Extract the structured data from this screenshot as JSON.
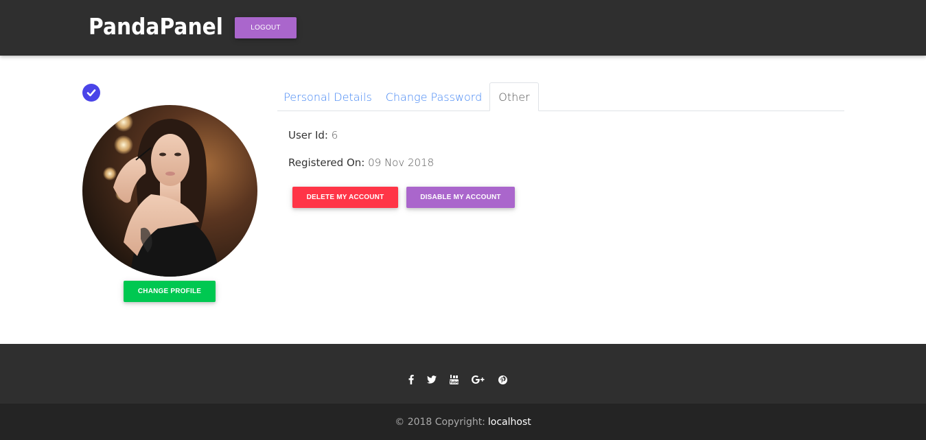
{
  "header": {
    "brand": "PandaPanel",
    "logout_label": "LOGOUT",
    "logout_color": "#aa66cc"
  },
  "profile": {
    "verified_icon": "check-circle-icon",
    "avatar_alt": "profile photo",
    "change_profile_label": "CHANGE PROFILE"
  },
  "tabs": [
    {
      "label": "Personal Details",
      "active": false
    },
    {
      "label": "Change Password",
      "active": false
    },
    {
      "label": "Other",
      "active": true
    }
  ],
  "other": {
    "user_id_label": "User Id:",
    "user_id_value": "6",
    "registered_label": "Registered On:",
    "registered_value": "09 Nov 2018",
    "delete_label": "DELETE MY ACCOUNT",
    "disable_label": "DISABLE MY ACCOUNT"
  },
  "footer": {
    "social_icons": [
      "facebook-icon",
      "twitter-icon",
      "youtube-icon",
      "google-plus-icon",
      "pinterest-icon"
    ],
    "copyright_text": "© 2018 Copyright:",
    "copyright_link": "localhost"
  },
  "colors": {
    "danger": "#ff3547",
    "secondary": "#aa66cc",
    "success": "#00c851",
    "primary_link": "#4285f4",
    "dark": "#2f2f2f"
  }
}
